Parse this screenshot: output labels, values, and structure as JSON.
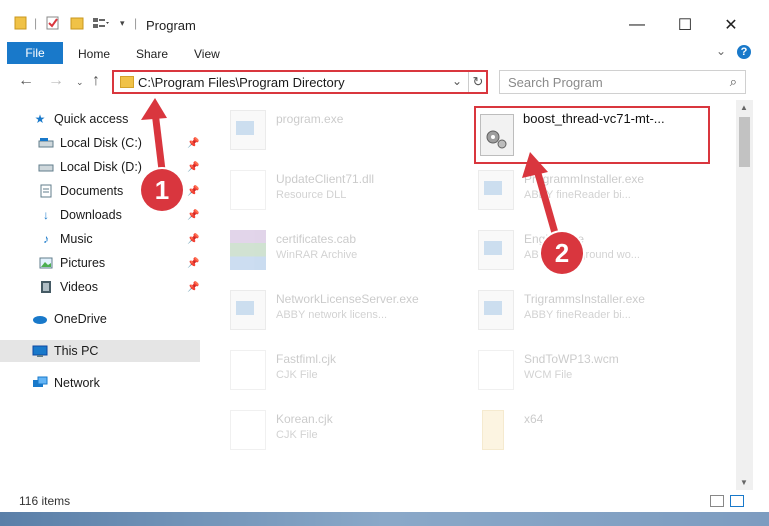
{
  "window": {
    "title": "Program"
  },
  "ribbon": {
    "file": "File",
    "home": "Home",
    "share": "Share",
    "view": "View"
  },
  "address": {
    "path": "C:\\Program Files\\Program Directory"
  },
  "search": {
    "placeholder": "Search Program"
  },
  "nav": {
    "items": [
      {
        "label": "Quick access",
        "icon": "star-icon"
      },
      {
        "label": "Local Disk (C:)",
        "icon": "drive-icon"
      },
      {
        "label": "Local Disk (D:)",
        "icon": "drive-icon"
      },
      {
        "label": "Documents",
        "icon": "documents-icon"
      },
      {
        "label": "Downloads",
        "icon": "download-icon"
      },
      {
        "label": "Music",
        "icon": "music-icon"
      },
      {
        "label": "Pictures",
        "icon": "pictures-icon"
      },
      {
        "label": "Videos",
        "icon": "videos-icon"
      },
      {
        "label": "OneDrive",
        "icon": "cloud-icon"
      },
      {
        "label": "This PC",
        "icon": "computer-icon"
      },
      {
        "label": "Network",
        "icon": "network-icon"
      }
    ]
  },
  "files": [
    {
      "name": "program.exe",
      "type": "",
      "icon": "exe"
    },
    {
      "name": "UpdateClient71.dll",
      "type": "Resource DLL",
      "icon": "doc"
    },
    {
      "name": "ProgrammInstaller.exe",
      "type": "ABBY fineReader bi...",
      "icon": "exe"
    },
    {
      "name": "certificates.cab",
      "type": "WinRAR Archive",
      "icon": "rar"
    },
    {
      "name": "Engine.exe",
      "type": "ABBY background wo...",
      "icon": "exe"
    },
    {
      "name": "NetworkLicenseServer.exe",
      "type": "ABBY network licens...",
      "icon": "exe"
    },
    {
      "name": "TrigrammsInstaller.exe",
      "type": "ABBY fineReader bi...",
      "icon": "exe"
    },
    {
      "name": "Fastfiml.cjk",
      "type": "CJK File",
      "icon": "doc"
    },
    {
      "name": "SndToWP13.wcm",
      "type": "WCM File",
      "icon": "doc"
    },
    {
      "name": "Korean.cjk",
      "type": "CJK File",
      "icon": "doc"
    },
    {
      "name": "x64",
      "type": "",
      "icon": "folder"
    }
  ],
  "highlighted_file": {
    "name": "boost_thread-vc71-mt-..."
  },
  "status": {
    "count": "116 items"
  },
  "callouts": {
    "one": "1",
    "two": "2"
  },
  "colors": {
    "accent": "#1979ca",
    "callout": "#d9363e"
  }
}
